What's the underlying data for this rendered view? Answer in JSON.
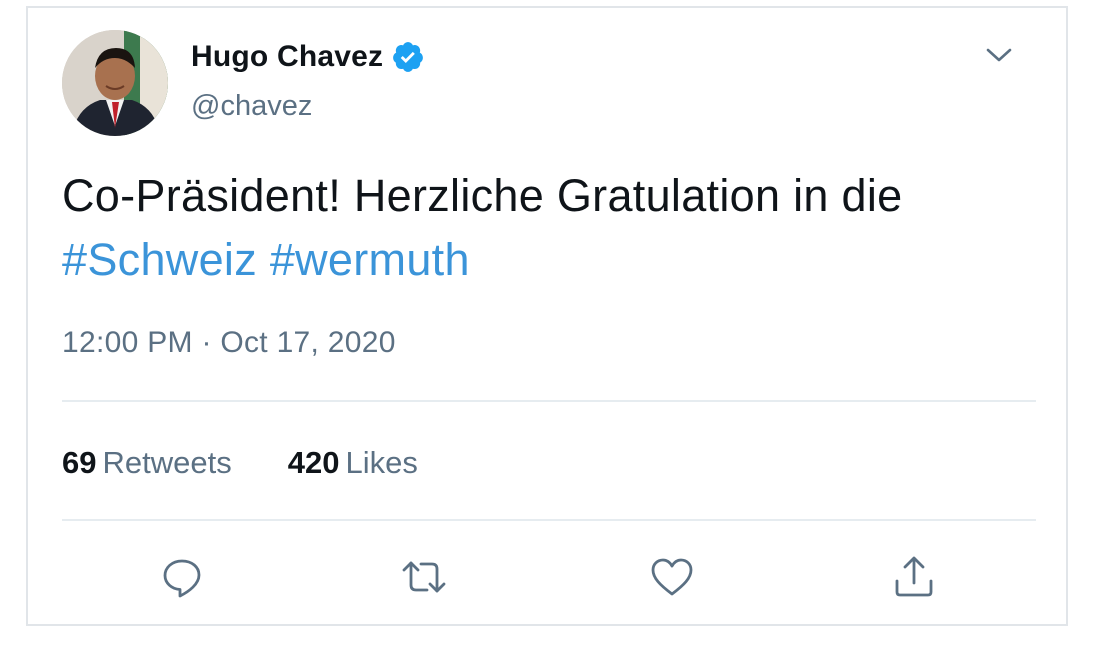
{
  "tweet": {
    "author_name": "Hugo Chavez",
    "author_handle": "@chavez",
    "verified": true,
    "text_plain": "Co-Präsident! Herzliche Gratulation in die ",
    "hashtags": [
      "#Schweiz",
      "#wermuth"
    ],
    "timestamp": "12:00 PM · Oct 17, 2020",
    "retweets_count": "69",
    "retweets_label": "Retweets",
    "likes_count": "420",
    "likes_label": "Likes"
  },
  "icons": {
    "verified": "verified-badge-icon",
    "menu": "chevron-down-icon",
    "reply": "reply-icon",
    "retweet": "retweet-icon",
    "like": "heart-icon",
    "share": "share-icon"
  },
  "colors": {
    "accent": "#1da1f2",
    "hashtag": "#3b94d9",
    "secondary_text": "#5b7083",
    "primary_text": "#0f1419",
    "border": "#e1e5e9"
  }
}
